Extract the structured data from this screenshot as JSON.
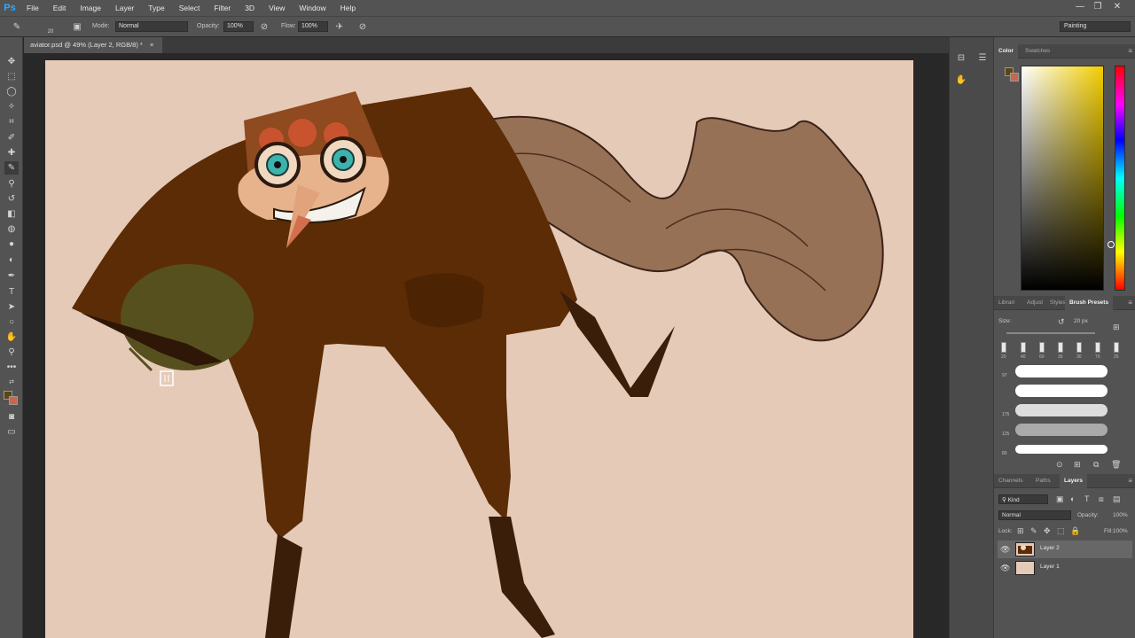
{
  "app": {
    "logo": "Ps"
  },
  "menu": [
    "File",
    "Edit",
    "Image",
    "Layer",
    "Type",
    "Select",
    "Filter",
    "3D",
    "View",
    "Window",
    "Help"
  ],
  "window_controls": [
    "—",
    "❐",
    "✕"
  ],
  "options": {
    "brush_size": "20",
    "mode_label": "Mode:",
    "mode_value": "Normal",
    "opacity_label": "Opacity:",
    "opacity_value": "100%",
    "flow_label": "Flow:",
    "flow_value": "100%",
    "workspace": "Painting"
  },
  "document": {
    "tab_title": "aviator.psd @ 49% (Layer 2, RGB/8) *",
    "close": "×"
  },
  "panels": {
    "color_tabs": [
      "Color",
      "Swatches"
    ],
    "brush_tabs": [
      "Librari",
      "Adjust",
      "Styles",
      "Brush Presets"
    ],
    "brush_size_label": "Size:",
    "brush_size_value": "20 px",
    "size_ticks": [
      "20",
      "40",
      "60",
      "35",
      "30",
      "70",
      "25"
    ],
    "brush_rows": [
      "97",
      "175",
      "125",
      "80"
    ],
    "layers_tabs": [
      "Channels",
      "Paths",
      "Layers"
    ],
    "layers_filter": "Kind",
    "blend_mode": "Normal",
    "opacity_label": "Opacity:",
    "opacity_value": "100%",
    "lock_label": "Lock:",
    "fill_label": "Fill:",
    "fill_value": "100%",
    "layers": [
      {
        "name": "Layer 2",
        "selected": true
      },
      {
        "name": "Layer 1",
        "selected": false
      }
    ]
  },
  "colors": {
    "foreground": "#5a4617",
    "background": "#c8674a",
    "canvas_bg": "#e6cab8",
    "accent_blue": "#31a8ff"
  }
}
